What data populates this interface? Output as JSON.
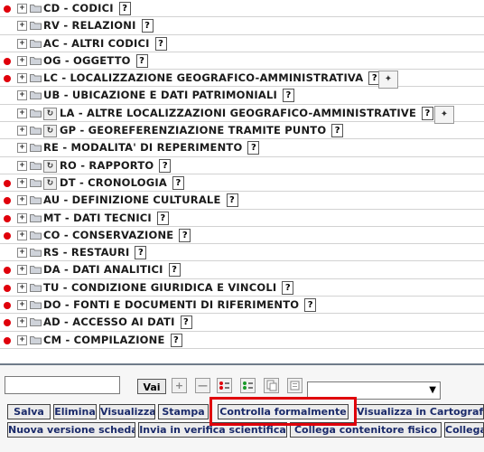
{
  "tree": {
    "rows": [
      {
        "code": "CD - CODICI",
        "red": true,
        "reload": false,
        "map": false
      },
      {
        "code": "RV - RELAZIONI",
        "red": false,
        "reload": false,
        "map": false
      },
      {
        "code": "AC - ALTRI CODICI",
        "red": false,
        "reload": false,
        "map": false
      },
      {
        "code": "OG - OGGETTO",
        "red": true,
        "reload": false,
        "map": false
      },
      {
        "code": "LC - LOCALIZZAZIONE GEOGRAFICO-AMMINISTRATIVA",
        "red": true,
        "reload": false,
        "map": true
      },
      {
        "code": "UB - UBICAZIONE E DATI PATRIMONIALI",
        "red": false,
        "reload": false,
        "map": false
      },
      {
        "code": "LA - ALTRE LOCALIZZAZIONI GEOGRAFICO-AMMINISTRATIVE",
        "red": false,
        "reload": true,
        "map": true
      },
      {
        "code": "GP - GEOREFERENZIAZIONE TRAMITE PUNTO",
        "red": false,
        "reload": true,
        "map": false
      },
      {
        "code": "RE - MODALITA' DI REPERIMENTO",
        "red": false,
        "reload": false,
        "map": false
      },
      {
        "code": "RO - RAPPORTO",
        "red": false,
        "reload": true,
        "map": false
      },
      {
        "code": "DT - CRONOLOGIA",
        "red": true,
        "reload": true,
        "map": false
      },
      {
        "code": "AU - DEFINIZIONE CULTURALE",
        "red": true,
        "reload": false,
        "map": false
      },
      {
        "code": "MT - DATI TECNICI",
        "red": true,
        "reload": false,
        "map": false
      },
      {
        "code": "CO - CONSERVAZIONE",
        "red": true,
        "reload": false,
        "map": false
      },
      {
        "code": "RS - RESTAURI",
        "red": false,
        "reload": false,
        "map": false
      },
      {
        "code": "DA - DATI ANALITICI",
        "red": true,
        "reload": false,
        "map": false
      },
      {
        "code": "TU - CONDIZIONE GIURIDICA E VINCOLI",
        "red": true,
        "reload": false,
        "map": false
      },
      {
        "code": "DO - FONTI E DOCUMENTI DI RIFERIMENTO",
        "red": true,
        "reload": false,
        "map": false
      },
      {
        "code": "AD - ACCESSO AI DATI",
        "red": true,
        "reload": false,
        "map": false
      },
      {
        "code": "CM - COMPILAZIONE",
        "red": true,
        "reload": false,
        "map": false
      }
    ],
    "help_glyph": "?",
    "expand_glyph": "+",
    "reload_glyph": "↻",
    "map_glyph": "✦"
  },
  "toolbar": {
    "search_value": "",
    "go_label": "Vai",
    "add_glyph": "+",
    "remove_glyph": "—",
    "icons": [
      "add-icon",
      "remove-icon",
      "red-bullets-icon",
      "green-bullets-icon",
      "copy-icon",
      "list-icon"
    ],
    "select_value": ""
  },
  "actions": {
    "row1": [
      "Salva",
      "Elimina",
      "Visualizza",
      "Stampa",
      "Controlla formalmente",
      "Visualizza in Cartografia"
    ],
    "row2": [
      "Nuova versione scheda",
      "Invia in verifica scientifica",
      "Collega contenitore fisico",
      "Collega"
    ]
  },
  "colors": {
    "red_dot": "#e0000b",
    "highlight": "#e0000b",
    "button_text": "#1a2a6a"
  }
}
